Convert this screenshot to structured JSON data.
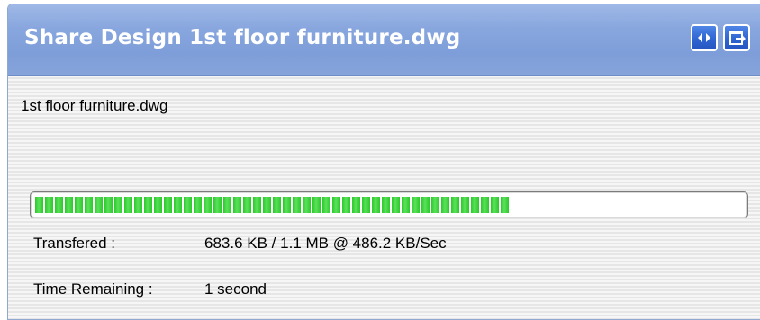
{
  "window": {
    "title": "Share Design 1st floor furniture.dwg",
    "buttons": [
      {
        "icon": "swap-arrows-icon"
      },
      {
        "icon": "dock-icon"
      }
    ]
  },
  "content": {
    "filename": "1st floor furniture.dwg",
    "progress": {
      "fraction": 0.67
    },
    "transfer_label": "Transfered :",
    "transfer_value": "683.6 KB / 1.1 MB @ 486.2 KB/Sec",
    "remaining_label": "Time Remaining :",
    "remaining_value": "1 second"
  },
  "colors": {
    "titlebar": "#86a3da",
    "progress_fill": "#2ac92a",
    "button_blue": "#2f66d2"
  }
}
